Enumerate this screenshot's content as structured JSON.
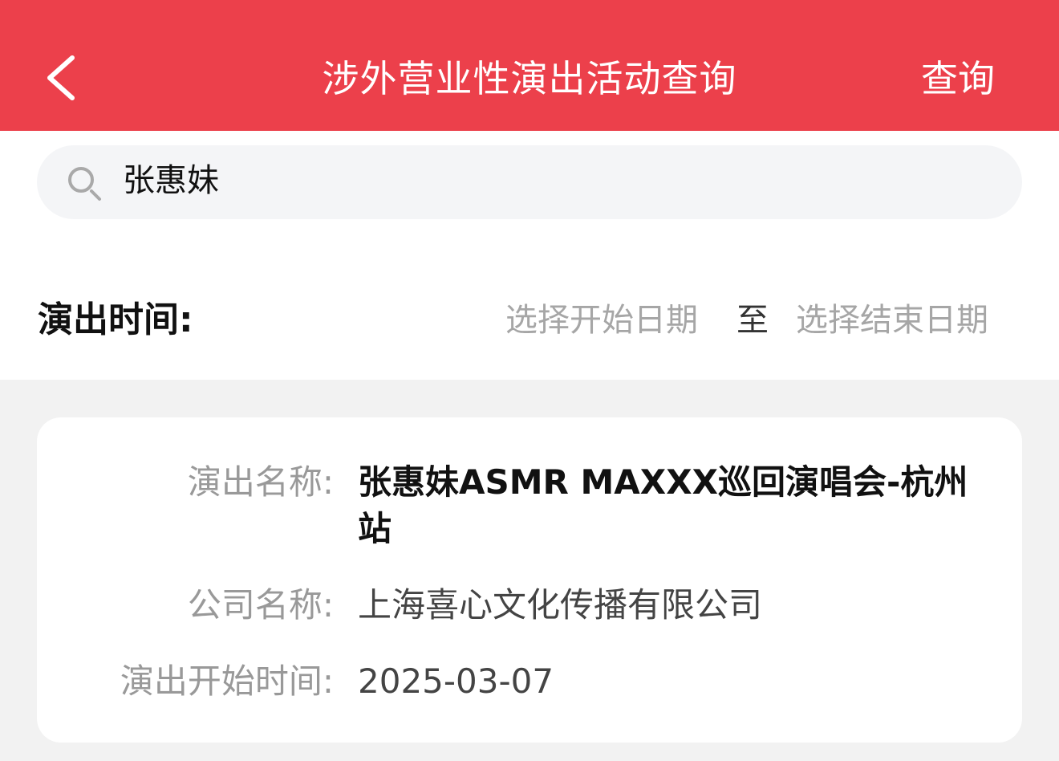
{
  "header": {
    "title": "涉外营业性演出活动查询",
    "query_label": "查询",
    "background_color": "#ec404b",
    "back_icon": "chevron-left-icon"
  },
  "search": {
    "value": "张惠妹",
    "icon": "search-icon"
  },
  "filter": {
    "time_label": "演出时间:",
    "start_placeholder": "选择开始日期",
    "separator": "至",
    "end_placeholder": "选择结束日期"
  },
  "result": {
    "name_label": "演出名称:",
    "name_value": "张惠妹ASMR MAXXX巡回演唱会-杭州站",
    "company_label": "公司名称:",
    "company_value": "上海喜心文化传播有限公司",
    "start_label": "演出开始时间:",
    "start_value": "2025-03-07"
  }
}
